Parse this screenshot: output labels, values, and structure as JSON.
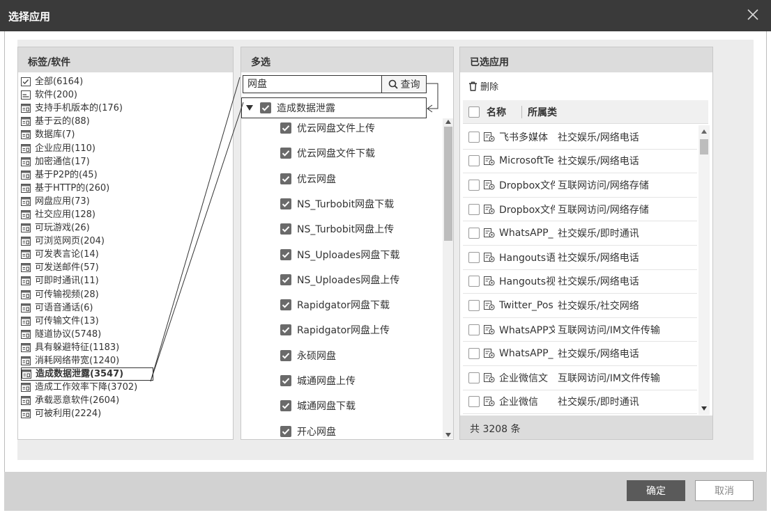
{
  "window": {
    "title": "选择应用",
    "close_label": "✕"
  },
  "left_panel": {
    "header": "标签/软件",
    "items": [
      {
        "label": "全部(6164)",
        "icon": "checklist-icon"
      },
      {
        "label": "软件(200)",
        "icon": "folder-icon"
      },
      {
        "label": "支持手机版本的(176)",
        "icon": "app-icon"
      },
      {
        "label": "基于云的(88)",
        "icon": "app-icon"
      },
      {
        "label": "数据库(7)",
        "icon": "app-icon"
      },
      {
        "label": "企业应用(110)",
        "icon": "app-icon"
      },
      {
        "label": "加密通信(17)",
        "icon": "app-icon"
      },
      {
        "label": "基于P2P的(45)",
        "icon": "app-icon"
      },
      {
        "label": "基于HTTP的(260)",
        "icon": "app-icon"
      },
      {
        "label": "网盘应用(73)",
        "icon": "app-icon"
      },
      {
        "label": "社交应用(128)",
        "icon": "app-icon"
      },
      {
        "label": "可玩游戏(26)",
        "icon": "app-icon"
      },
      {
        "label": "可浏览网页(204)",
        "icon": "app-icon"
      },
      {
        "label": "可发表言论(14)",
        "icon": "app-icon"
      },
      {
        "label": "可发送邮件(57)",
        "icon": "app-icon"
      },
      {
        "label": "可即时通讯(11)",
        "icon": "app-icon"
      },
      {
        "label": "可传输视频(28)",
        "icon": "app-icon"
      },
      {
        "label": "可语音通话(6)",
        "icon": "app-icon"
      },
      {
        "label": "可传输文件(13)",
        "icon": "app-icon"
      },
      {
        "label": "隧道协议(5748)",
        "icon": "app-icon"
      },
      {
        "label": "具有躲避特征(1183)",
        "icon": "app-icon"
      },
      {
        "label": "消耗网络带宽(1240)",
        "icon": "app-icon"
      },
      {
        "label": "造成数据泄露(3547)",
        "icon": "app-icon"
      },
      {
        "label": "造成工作效率下降(3702)",
        "icon": "app-icon"
      },
      {
        "label": "承载恶意软件(2604)",
        "icon": "app-icon"
      },
      {
        "label": "可被利用(2224)",
        "icon": "app-icon"
      }
    ]
  },
  "middle_panel": {
    "header": "多选",
    "search_value": "网盘",
    "query_label": "查询",
    "tree_root": {
      "label": "造成数据泄露",
      "checked": true
    },
    "children": [
      {
        "label": "优云网盘文件上传",
        "checked": true
      },
      {
        "label": "优云网盘文件下载",
        "checked": true
      },
      {
        "label": "优云网盘",
        "checked": true
      },
      {
        "label": "NS_Turbobit网盘下载",
        "checked": true
      },
      {
        "label": "NS_Turbobit网盘上传",
        "checked": true
      },
      {
        "label": "NS_Uploades网盘下载",
        "checked": true
      },
      {
        "label": "NS_Uploades网盘上传",
        "checked": true
      },
      {
        "label": "Rapidgator网盘下载",
        "checked": true
      },
      {
        "label": "Rapidgator网盘上传",
        "checked": true
      },
      {
        "label": "永硕网盘",
        "checked": true
      },
      {
        "label": "城通网盘上传",
        "checked": true
      },
      {
        "label": "城通网盘下载",
        "checked": true
      },
      {
        "label": "开心网盘",
        "checked": true
      }
    ]
  },
  "right_panel": {
    "header": "已选应用",
    "delete_label": "删除",
    "col_name": "名称",
    "col_category": "所属类",
    "rows": [
      {
        "name": "飞书多媒体",
        "category": "社交娱乐/网络电话"
      },
      {
        "name": "MicrosoftTe",
        "category": "社交娱乐/网络电话"
      },
      {
        "name": "Dropbox文件",
        "category": "互联网访问/网络存储"
      },
      {
        "name": "Dropbox文件",
        "category": "互联网访问/网络存储"
      },
      {
        "name": "WhatsAPP_",
        "category": "社交娱乐/即时通讯"
      },
      {
        "name": "Hangouts语",
        "category": "社交娱乐/网络电话"
      },
      {
        "name": "Hangouts视",
        "category": "社交娱乐/网络电话"
      },
      {
        "name": "Twitter_Pos",
        "category": "社交娱乐/社交网络"
      },
      {
        "name": "WhatsAPP文",
        "category": "互联网访问/IM文件传输"
      },
      {
        "name": "WhatsAPP_",
        "category": "社交娱乐/网络电话"
      },
      {
        "name": "企业微信文",
        "category": "互联网访问/IM文件传输"
      },
      {
        "name": "企业微信",
        "category": "社交娱乐/即时通讯"
      }
    ],
    "footer": "共 3208 条"
  },
  "footer": {
    "ok_label": "确定",
    "cancel_label": "取消"
  },
  "colors": {
    "titlebar": "#3a3a3a",
    "panel_header": "#dcdcdc",
    "checkbox_on": "#6a6a6a",
    "ok_button": "#5a5a5a"
  }
}
